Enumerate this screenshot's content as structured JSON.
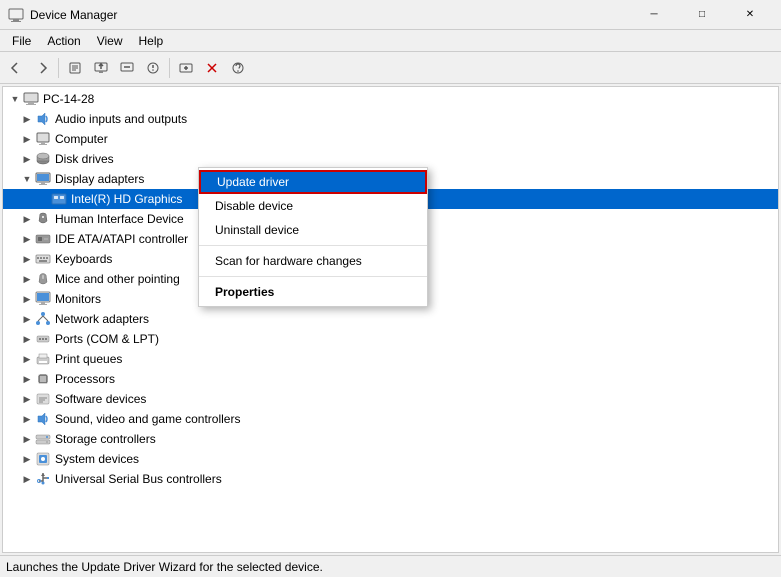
{
  "titleBar": {
    "title": "Device Manager",
    "icon": "💻",
    "controls": {
      "minimize": "─",
      "maximize": "□",
      "close": "✕"
    }
  },
  "menuBar": {
    "items": [
      "File",
      "Action",
      "View",
      "Help"
    ]
  },
  "toolbar": {
    "buttons": [
      {
        "name": "back",
        "icon": "◀"
      },
      {
        "name": "forward",
        "icon": "▶"
      },
      {
        "name": "up",
        "icon": "📁"
      },
      {
        "name": "properties",
        "icon": "📋"
      },
      {
        "name": "update-driver",
        "icon": "🖥"
      },
      {
        "name": "scan",
        "icon": "🔍"
      },
      {
        "name": "driver-icon",
        "icon": "💾"
      },
      {
        "name": "add",
        "icon": "➕"
      },
      {
        "name": "remove",
        "icon": "✕"
      },
      {
        "name": "help",
        "icon": "❓"
      }
    ]
  },
  "tree": {
    "root": {
      "label": "PC-14-28",
      "icon": "💻",
      "expanded": true
    },
    "items": [
      {
        "label": "Audio inputs and outputs",
        "icon": "🔊",
        "indent": 2,
        "expanded": false
      },
      {
        "label": "Computer",
        "icon": "🖥",
        "indent": 2,
        "expanded": false
      },
      {
        "label": "Disk drives",
        "icon": "💾",
        "indent": 2,
        "expanded": false
      },
      {
        "label": "Display adapters",
        "icon": "📺",
        "indent": 2,
        "expanded": true
      },
      {
        "label": "Intel(R) HD Graphics",
        "icon": "🖥",
        "indent": 3,
        "selected": true
      },
      {
        "label": "Human Interface Device",
        "icon": "🖱",
        "indent": 2,
        "expanded": false
      },
      {
        "label": "IDE ATA/ATAPI controller",
        "icon": "💾",
        "indent": 2,
        "expanded": false
      },
      {
        "label": "Keyboards",
        "icon": "⌨",
        "indent": 2,
        "expanded": false
      },
      {
        "label": "Mice and other pointing",
        "icon": "🖱",
        "indent": 2,
        "expanded": false
      },
      {
        "label": "Monitors",
        "icon": "📺",
        "indent": 2,
        "expanded": false
      },
      {
        "label": "Network adapters",
        "icon": "🌐",
        "indent": 2,
        "expanded": false
      },
      {
        "label": "Ports (COM & LPT)",
        "icon": "🔌",
        "indent": 2,
        "expanded": false
      },
      {
        "label": "Print queues",
        "icon": "🖨",
        "indent": 2,
        "expanded": false
      },
      {
        "label": "Processors",
        "icon": "💻",
        "indent": 2,
        "expanded": false
      },
      {
        "label": "Software devices",
        "icon": "💻",
        "indent": 2,
        "expanded": false
      },
      {
        "label": "Sound, video and game controllers",
        "icon": "🔊",
        "indent": 2,
        "expanded": false
      },
      {
        "label": "Storage controllers",
        "icon": "💾",
        "indent": 2,
        "expanded": false
      },
      {
        "label": "System devices",
        "icon": "💻",
        "indent": 2,
        "expanded": false
      },
      {
        "label": "Universal Serial Bus controllers",
        "icon": "🔌",
        "indent": 2,
        "expanded": false
      }
    ]
  },
  "contextMenu": {
    "items": [
      {
        "label": "Update driver",
        "highlighted": true
      },
      {
        "label": "Disable device",
        "highlighted": false
      },
      {
        "label": "Uninstall device",
        "highlighted": false
      },
      {
        "separator": true
      },
      {
        "label": "Scan for hardware changes",
        "highlighted": false
      },
      {
        "separator": true
      },
      {
        "label": "Properties",
        "highlighted": false,
        "bold": true
      }
    ]
  },
  "statusBar": {
    "text": "Launches the Update Driver Wizard for the selected device."
  }
}
